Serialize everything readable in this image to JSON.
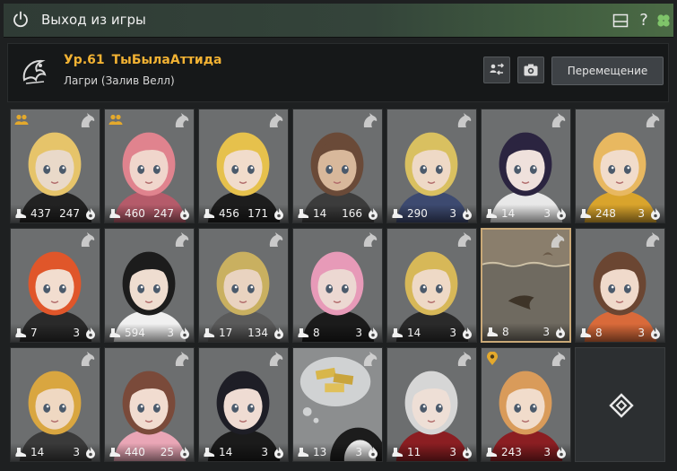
{
  "window": {
    "title": "Выход из игры"
  },
  "character": {
    "level": "Ур.61",
    "name": "ТыБылаАттида",
    "location": "Лагри (Залив Велл)"
  },
  "actions": {
    "move_label": "Перемещение"
  },
  "colors": {
    "accent": "#f2b233",
    "selected_border": "#c9a877"
  },
  "slots": [
    {
      "v1": "437",
      "v2": "247",
      "skin": "#e9d9c9",
      "hair": "#e6c46a",
      "bg": "#6c6e6f",
      "cloth": "#222222",
      "family": true
    },
    {
      "v1": "460",
      "v2": "247",
      "skin": "#f0d6cc",
      "hair": "#e0838e",
      "bg": "#6c6e6f",
      "cloth": "#b55b6a",
      "family": true
    },
    {
      "v1": "456",
      "v2": "171",
      "skin": "#f1dccb",
      "hair": "#e6c14c",
      "bg": "#6c6e6f",
      "cloth": "#1d1d1d"
    },
    {
      "v1": "14",
      "v2": "166",
      "skin": "#d8b89b",
      "hair": "#6a4a38",
      "bg": "#6c6e6f",
      "cloth": "#3c3c3c"
    },
    {
      "v1": "290",
      "v2": "3",
      "skin": "#eed9c6",
      "hair": "#d9c060",
      "bg": "#6c6e6f",
      "cloth": "#3d4a70"
    },
    {
      "v1": "14",
      "v2": "3",
      "skin": "#efe1dc",
      "hair": "#2b2440",
      "bg": "#6c6e6f",
      "cloth": "#e8e8e8"
    },
    {
      "v1": "248",
      "v2": "3",
      "skin": "#f1dccb",
      "hair": "#e8b860",
      "bg": "#6c6e6f",
      "cloth": "#d9a42c"
    },
    {
      "v1": "7",
      "v2": "3",
      "skin": "#f2ddcf",
      "hair": "#e0562a",
      "bg": "#6c6e6f",
      "cloth": "#2a2a2a"
    },
    {
      "v1": "594",
      "v2": "3",
      "skin": "#efddd0",
      "hair": "#1c1c1c",
      "bg": "#6c6e6f",
      "cloth": "#f0f0f0"
    },
    {
      "v1": "17",
      "v2": "134",
      "skin": "#e9d3c0",
      "hair": "#c9b060",
      "bg": "#6c6e6f",
      "cloth": "#5a5a5a"
    },
    {
      "v1": "8",
      "v2": "3",
      "skin": "#ecd8d2",
      "hair": "#e79ab8",
      "bg": "#6c6e6f",
      "cloth": "#1b1b1b"
    },
    {
      "v1": "14",
      "v2": "3",
      "skin": "#eed9c6",
      "hair": "#d7b858",
      "bg": "#6c6e6f",
      "cloth": "#2a2a2a"
    },
    {
      "v1": "8",
      "v2": "3",
      "skin": "#8a7d6a",
      "hair": "#3b3128",
      "bg": "#7a7060",
      "cloth": "#6b6050",
      "selected": true,
      "scene": "water"
    },
    {
      "v1": "8",
      "v2": "3",
      "skin": "#f0dacb",
      "hair": "#6b4632",
      "bg": "#6c6e6f",
      "cloth": "#d96a3a"
    },
    {
      "v1": "14",
      "v2": "3",
      "skin": "#efd8c2",
      "hair": "#d9a640",
      "bg": "#6c6e6f",
      "cloth": "#3a3a3a"
    },
    {
      "v1": "440",
      "v2": "25",
      "skin": "#f1dcd0",
      "hair": "#7a4a3a",
      "bg": "#6c6e6f",
      "cloth": "#e9a6b6"
    },
    {
      "v1": "14",
      "v2": "3",
      "skin": "#efdcd3",
      "hair": "#1e1e26",
      "bg": "#6c6e6f",
      "cloth": "#1b1b1b"
    },
    {
      "v1": "13",
      "v2": "3",
      "skin": "#e7e7e7",
      "hair": "#1c1c1c",
      "bg": "#8a8c8d",
      "cloth": "#202020",
      "scene": "gold"
    },
    {
      "v1": "11",
      "v2": "3",
      "skin": "#eedfd6",
      "hair": "#d6d6d6",
      "bg": "#6c6e6f",
      "cloth": "#8b1e22"
    },
    {
      "v1": "243",
      "v2": "3",
      "skin": "#f1dccb",
      "hair": "#d99b5a",
      "bg": "#6c6e6f",
      "cloth": "#8b1e22",
      "pin": true
    },
    {
      "empty": true
    }
  ]
}
